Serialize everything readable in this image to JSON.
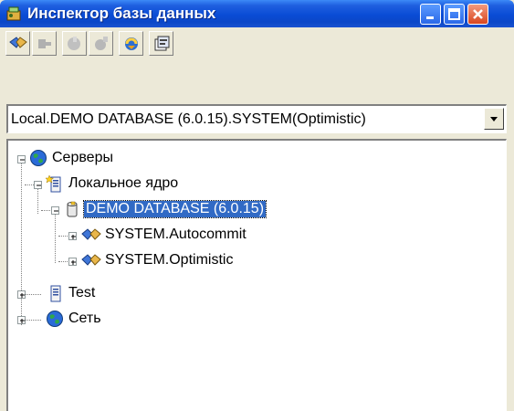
{
  "window": {
    "title": "Инспектор базы данных",
    "controls": [
      "minimize-icon",
      "maximize-icon",
      "close-icon"
    ]
  },
  "toolbar": {
    "buttons": [
      {
        "icon": "connect-icon",
        "enabled": true
      },
      {
        "icon": "disconnect-icon",
        "enabled": false
      },
      {
        "icon": "add-database-icon",
        "enabled": false
      },
      {
        "icon": "remove-database-icon",
        "enabled": false
      },
      {
        "icon": "refresh-icon",
        "enabled": true
      },
      {
        "icon": "properties-icon",
        "enabled": true
      }
    ]
  },
  "connection": {
    "value": "Local.DEMO DATABASE (6.0.15).SYSTEM(Optimistic)"
  },
  "tree": {
    "nodes": [
      {
        "label": "Серверы",
        "icon": "globe-icon",
        "expanded": true
      },
      {
        "label": "Локальное ядро",
        "icon": "server-icon",
        "expanded": true
      },
      {
        "label": "DEMO DATABASE (6.0.15)",
        "icon": "database-icon",
        "expanded": true,
        "selected": true
      },
      {
        "label": "SYSTEM.Autocommit",
        "icon": "handshake-icon",
        "expanded": false
      },
      {
        "label": "SYSTEM.Optimistic",
        "icon": "handshake-icon",
        "expanded": false
      },
      {
        "label": "Test",
        "icon": "server-icon",
        "expanded": false
      },
      {
        "label": "Сеть",
        "icon": "globe-icon",
        "expanded": false
      }
    ]
  }
}
